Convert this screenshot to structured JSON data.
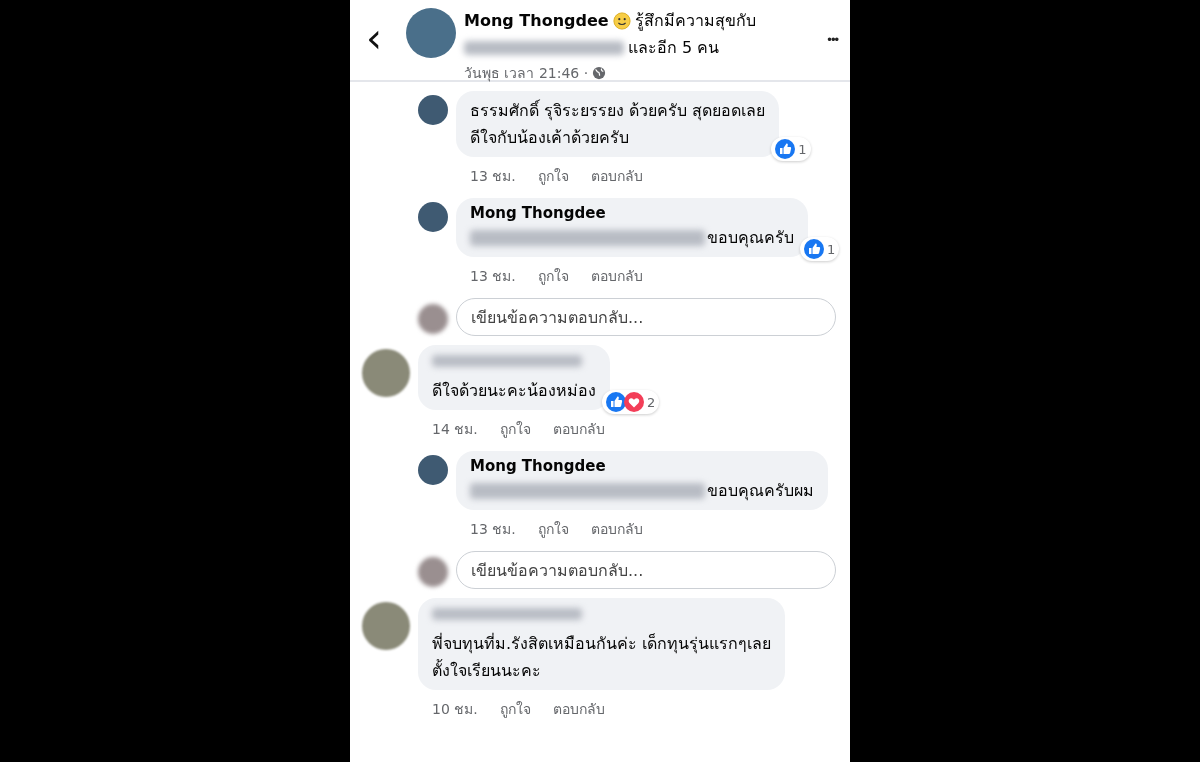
{
  "header": {
    "back": "‹",
    "name": "Mong Thongdee",
    "feeling": "รู้สึกมีความสุขกับ",
    "others": "และอีก 5 คน",
    "time": "วันพุธ เวลา 21:46 ·",
    "more": "•••"
  },
  "threads": [
    {
      "replies": [
        {
          "kind": "comment",
          "lines": [
            "ธรรมศักดิ์ รุจิระยรรยง ด้วยครับ สุดยอดเลย",
            "ดีใจกับน้องเค้าด้วยครับ"
          ],
          "time": "13 ชม.",
          "like": "ถูกใจ",
          "reply": "ตอบกลับ",
          "reactions": [
            {
              "kind": "like"
            }
          ],
          "count": "1"
        },
        {
          "kind": "comment",
          "author": "Mong Thongdee",
          "mention_hidden": true,
          "lines": [
            "ขอบคุณครับ"
          ],
          "time": "13 ชม.",
          "like": "ถูกใจ",
          "reply": "ตอบกลับ",
          "reactions": [
            {
              "kind": "like"
            }
          ],
          "count": "1"
        },
        {
          "kind": "reply-field",
          "placeholder": "เขียนข้อความตอบกลับ..."
        }
      ]
    },
    {
      "comment": {
        "kind": "comment",
        "author_hidden": true,
        "lines": [
          "ดีใจด้วยนะคะน้องหม่อง"
        ],
        "time": "14 ชม.",
        "like": "ถูกใจ",
        "reply": "ตอบกลับ",
        "reactions": [
          {
            "kind": "like"
          },
          {
            "kind": "love"
          }
        ],
        "count": "2"
      },
      "replies": [
        {
          "kind": "comment",
          "author": "Mong Thongdee",
          "mention_hidden": true,
          "lines": [
            "ขอบคุณครับผม"
          ],
          "time": "13 ชม.",
          "like": "ถูกใจ",
          "reply": "ตอบกลับ"
        },
        {
          "kind": "reply-field",
          "placeholder": "เขียนข้อความตอบกลับ..."
        }
      ]
    },
    {
      "comment": {
        "kind": "comment",
        "author_hidden": true,
        "lines": [
          "พี่จบทุนที่ม.รังสิตเหมือนกันค่ะ เด็กทุนรุ่นแรกๆเลย",
          "ตั้งใจเรียนนะคะ"
        ],
        "time": "10 ชม.",
        "like": "ถูกใจ",
        "reply": "ตอบกลับ"
      }
    }
  ]
}
